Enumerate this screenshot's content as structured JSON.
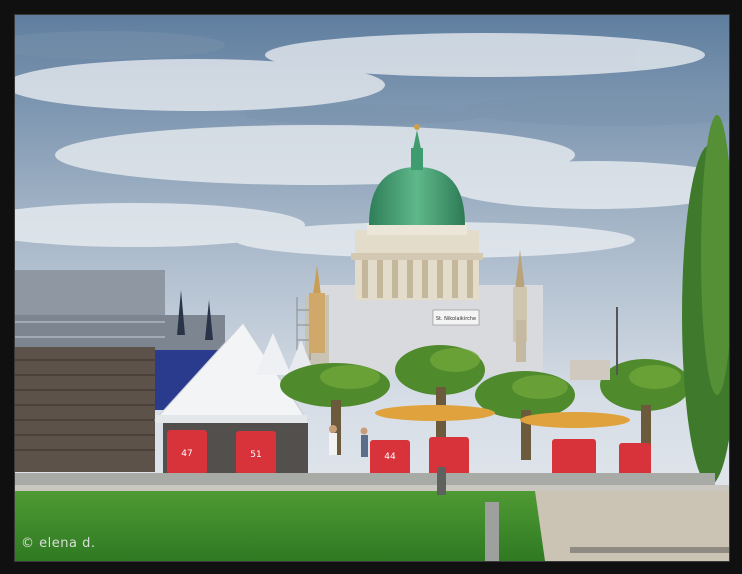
{
  "photo": {
    "watermark": "© elena d.",
    "church_sign": "St. Nikolaikirche",
    "beach_chair_numbers": [
      "47",
      "51",
      "44"
    ]
  },
  "colors": {
    "sky_top": "#6f8fb0",
    "sky_bottom": "#dfe6ee",
    "dome": "#3f9c6e",
    "grass": "#3f8f2f",
    "beach_chair": "#d8323a",
    "tent": "#f2f4f6"
  }
}
